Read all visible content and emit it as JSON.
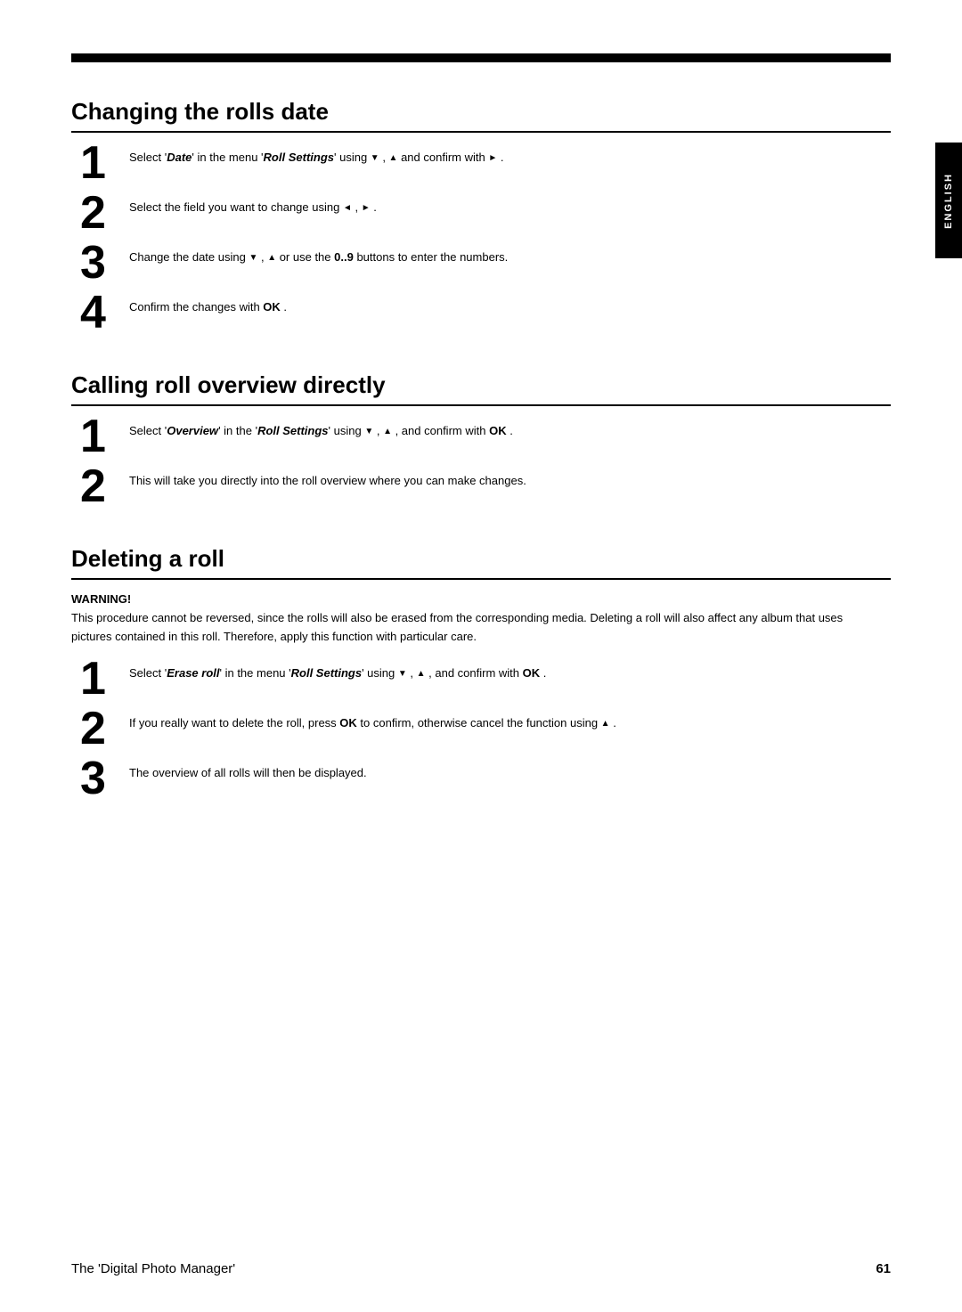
{
  "page": {
    "top_bar": "",
    "sidebar_label": "ENGLISH",
    "footer": {
      "title": "The 'Digital Photo Manager'",
      "page_number": "61"
    }
  },
  "sections": [
    {
      "id": "changing-rolls-date",
      "heading": "Changing the rolls date",
      "steps": [
        {
          "number": "1",
          "text": "Select 'Date' in the menu 'Roll Settings' using ▼ , ▲ and confirm with ► ."
        },
        {
          "number": "2",
          "text": "Select the field you want to change using ◄ , ► ."
        },
        {
          "number": "3",
          "text": "Change the date using ▼ , ▲ or use the 0..9 buttons to enter the numbers."
        },
        {
          "number": "4",
          "text": "Confirm the changes with OK ."
        }
      ]
    },
    {
      "id": "calling-roll-overview",
      "heading": "Calling roll overview directly",
      "steps": [
        {
          "number": "1",
          "text": "Select 'Overview' in the 'Roll Settings' using ▼ , ▲ , and confirm with OK ."
        },
        {
          "number": "2",
          "text": "This will take you directly into the roll overview where you can make changes."
        }
      ]
    },
    {
      "id": "deleting-a-roll",
      "heading": "Deleting a roll",
      "warning": {
        "label": "WARNING!",
        "text": "This procedure cannot be reversed, since the rolls will also be erased from the corresponding media. Deleting a roll will also affect any album that uses pictures contained in this roll. Therefore, apply this function with particular care."
      },
      "steps": [
        {
          "number": "1",
          "text": "Select 'Erase roll' in the menu 'Roll Settings' using ▼ , ▲ , and confirm with OK ."
        },
        {
          "number": "2",
          "text": "If you really want to delete the roll, press OK to confirm, otherwise cancel the function using ▲ ."
        },
        {
          "number": "3",
          "text": "The overview of all rolls will then be displayed."
        }
      ]
    }
  ]
}
